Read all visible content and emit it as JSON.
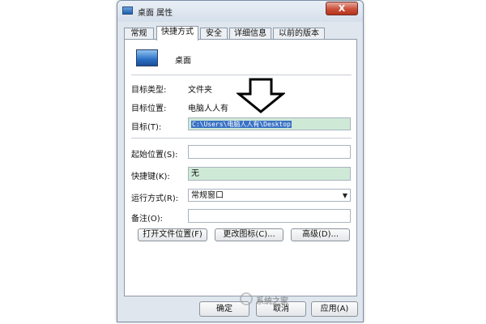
{
  "window": {
    "title": "桌面 属性",
    "close_label": "X"
  },
  "tabs": [
    {
      "label": "常规"
    },
    {
      "label": "快捷方式"
    },
    {
      "label": "安全"
    },
    {
      "label": "详细信息"
    },
    {
      "label": "以前的版本"
    }
  ],
  "shortcut": {
    "name": "桌面",
    "target_type_label": "目标类型:",
    "target_type_value": "文件夹",
    "target_location_label": "目标位置:",
    "target_location_value": "电脑人人有",
    "target_label": "目标(T):",
    "target_value": "C:\\Users\\电脑人人有\\Desktop",
    "start_in_label": "起始位置(S):",
    "start_in_value": "",
    "hotkey_label": "快捷键(K):",
    "hotkey_value": "无",
    "run_label": "运行方式(R):",
    "run_value": "常规窗口",
    "comment_label": "备注(O):",
    "comment_value": ""
  },
  "buttons": {
    "open_location": "打开文件位置(F)",
    "change_icon": "更改图标(C)...",
    "advanced": "高级(D)...",
    "ok": "确定",
    "cancel": "取消",
    "apply": "应用(A)"
  },
  "icons": {
    "title_icon": "desktop-icon",
    "shortcut_icon": "desktop-icon",
    "dropdown_icon": "chevron-down-icon"
  },
  "watermark": "系统之家"
}
